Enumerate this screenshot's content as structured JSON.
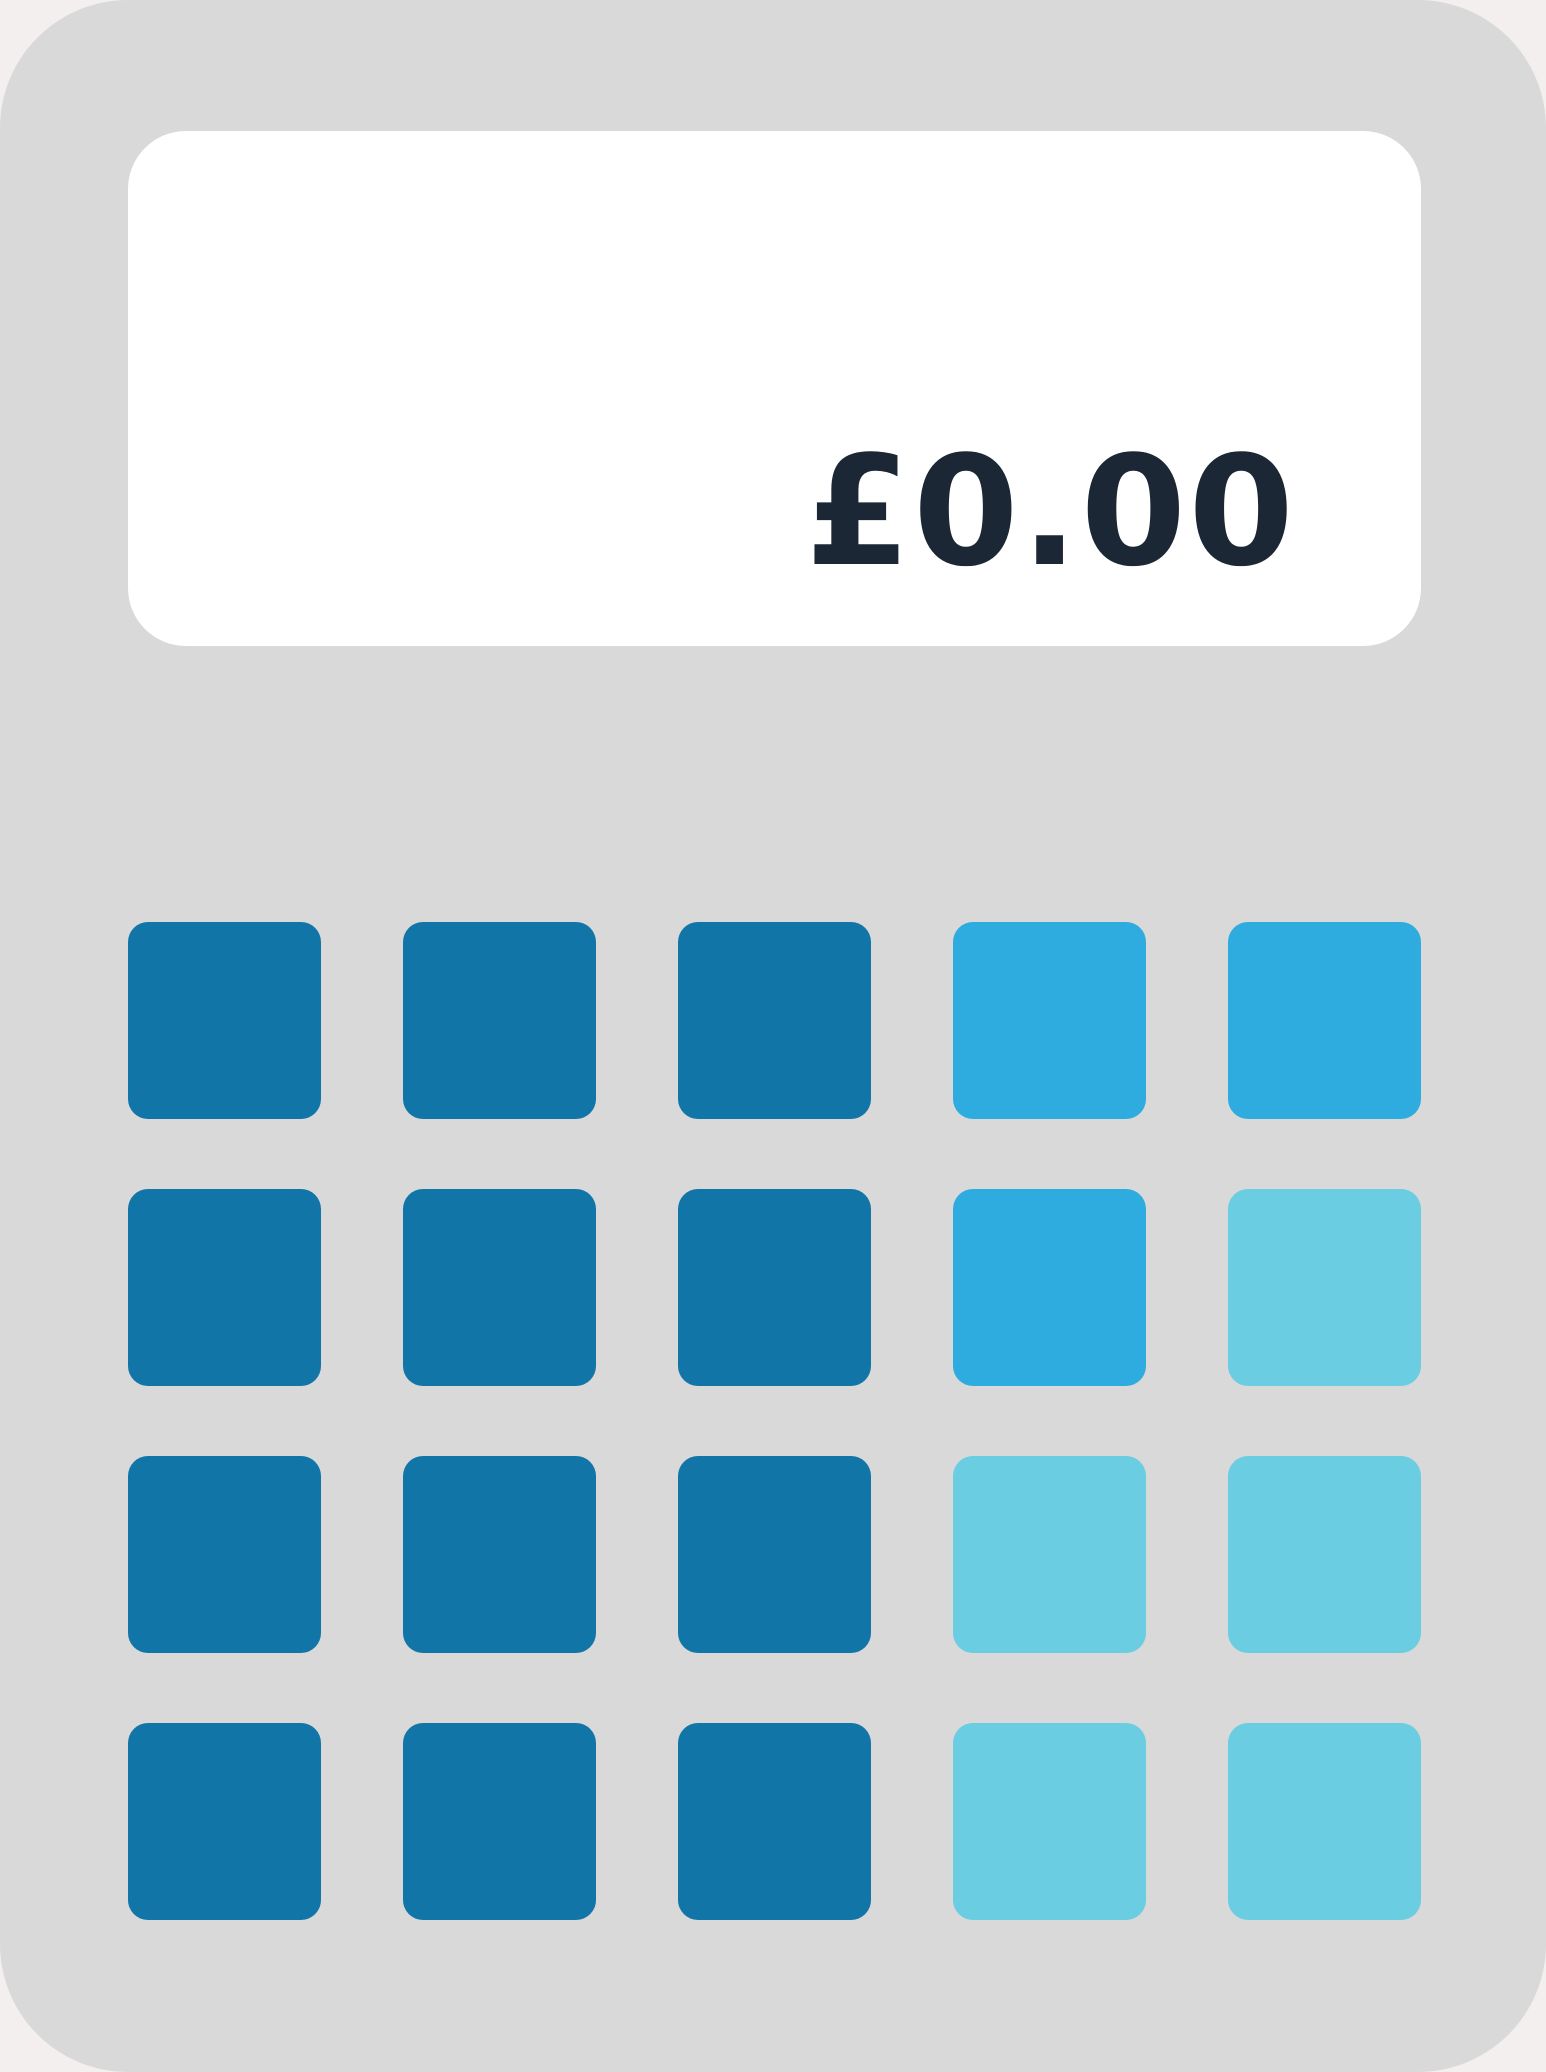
{
  "display": {
    "value": "£0.00"
  },
  "colors": {
    "body": "#d9d9d9",
    "screen": "#ffffff",
    "text": "#1c2735",
    "key_dark": "#1275a7",
    "key_medium": "#2eabdf",
    "key_light": "#6acde2"
  },
  "keypad": {
    "rows": [
      [
        "key_dark",
        "key_dark",
        "key_dark",
        "key_medium",
        "key_medium"
      ],
      [
        "key_dark",
        "key_dark",
        "key_dark",
        "key_medium",
        "key_light"
      ],
      [
        "key_dark",
        "key_dark",
        "key_dark",
        "key_light",
        "key_light"
      ],
      [
        "key_dark",
        "key_dark",
        "key_dark",
        "key_light",
        "key_light"
      ]
    ]
  }
}
